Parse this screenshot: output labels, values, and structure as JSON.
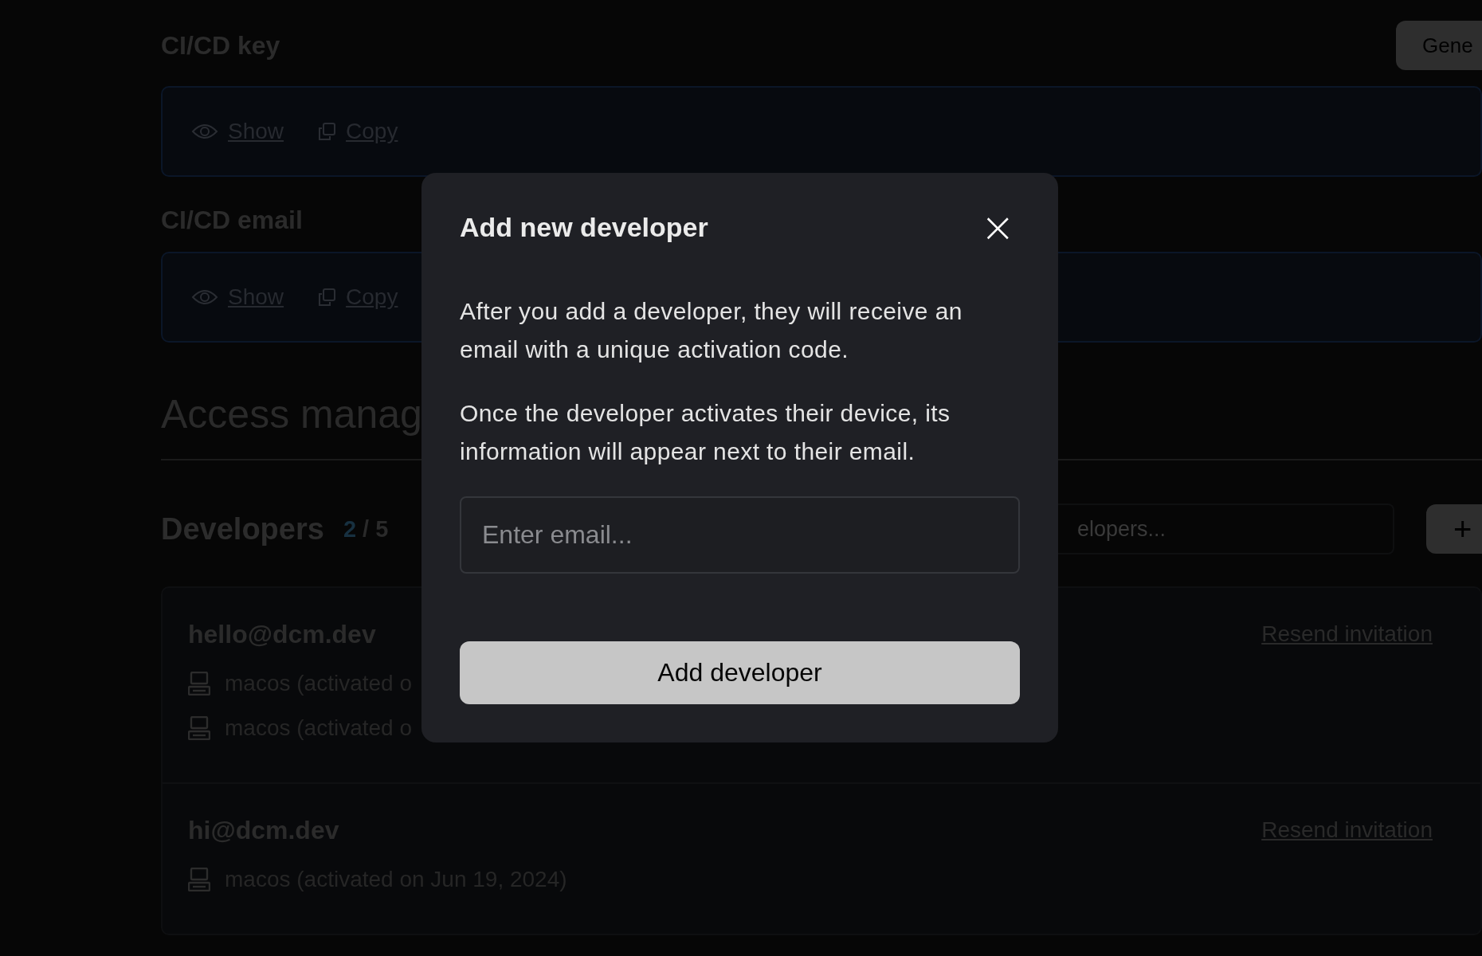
{
  "generate_button": {
    "label": "Gene"
  },
  "secrets": [
    {
      "title": "CI/CD key",
      "actions": [
        {
          "kind": "show",
          "label": "Show"
        },
        {
          "kind": "copy",
          "label": "Copy"
        }
      ]
    },
    {
      "title": "CI/CD email",
      "actions": [
        {
          "kind": "show",
          "label": "Show"
        },
        {
          "kind": "copy",
          "label": "Copy"
        }
      ]
    }
  ],
  "access_title": "Access manag",
  "developers": {
    "title": "Developers",
    "count": "2",
    "limit": "/ 5",
    "search": {
      "placeholder": "elopers..."
    },
    "add_button": {
      "label": "+"
    },
    "rows": [
      {
        "email": "hello@dcm.dev",
        "action": "Resend invitation",
        "devices": [
          "macos (activated o",
          "macos (activated o"
        ]
      },
      {
        "email": "hi@dcm.dev",
        "action": "Resend invitation",
        "devices": [
          "macos (activated on Jun 19, 2024)"
        ]
      }
    ]
  },
  "modal": {
    "title": "Add new developer",
    "close": "×",
    "paragraphs": [
      "After you add a developer, they will receive an email with a unique activation code.",
      "Once the developer activates their device, its information will appear next to their email."
    ],
    "input": {
      "placeholder": "Enter email..."
    },
    "button": "Add developer"
  }
}
